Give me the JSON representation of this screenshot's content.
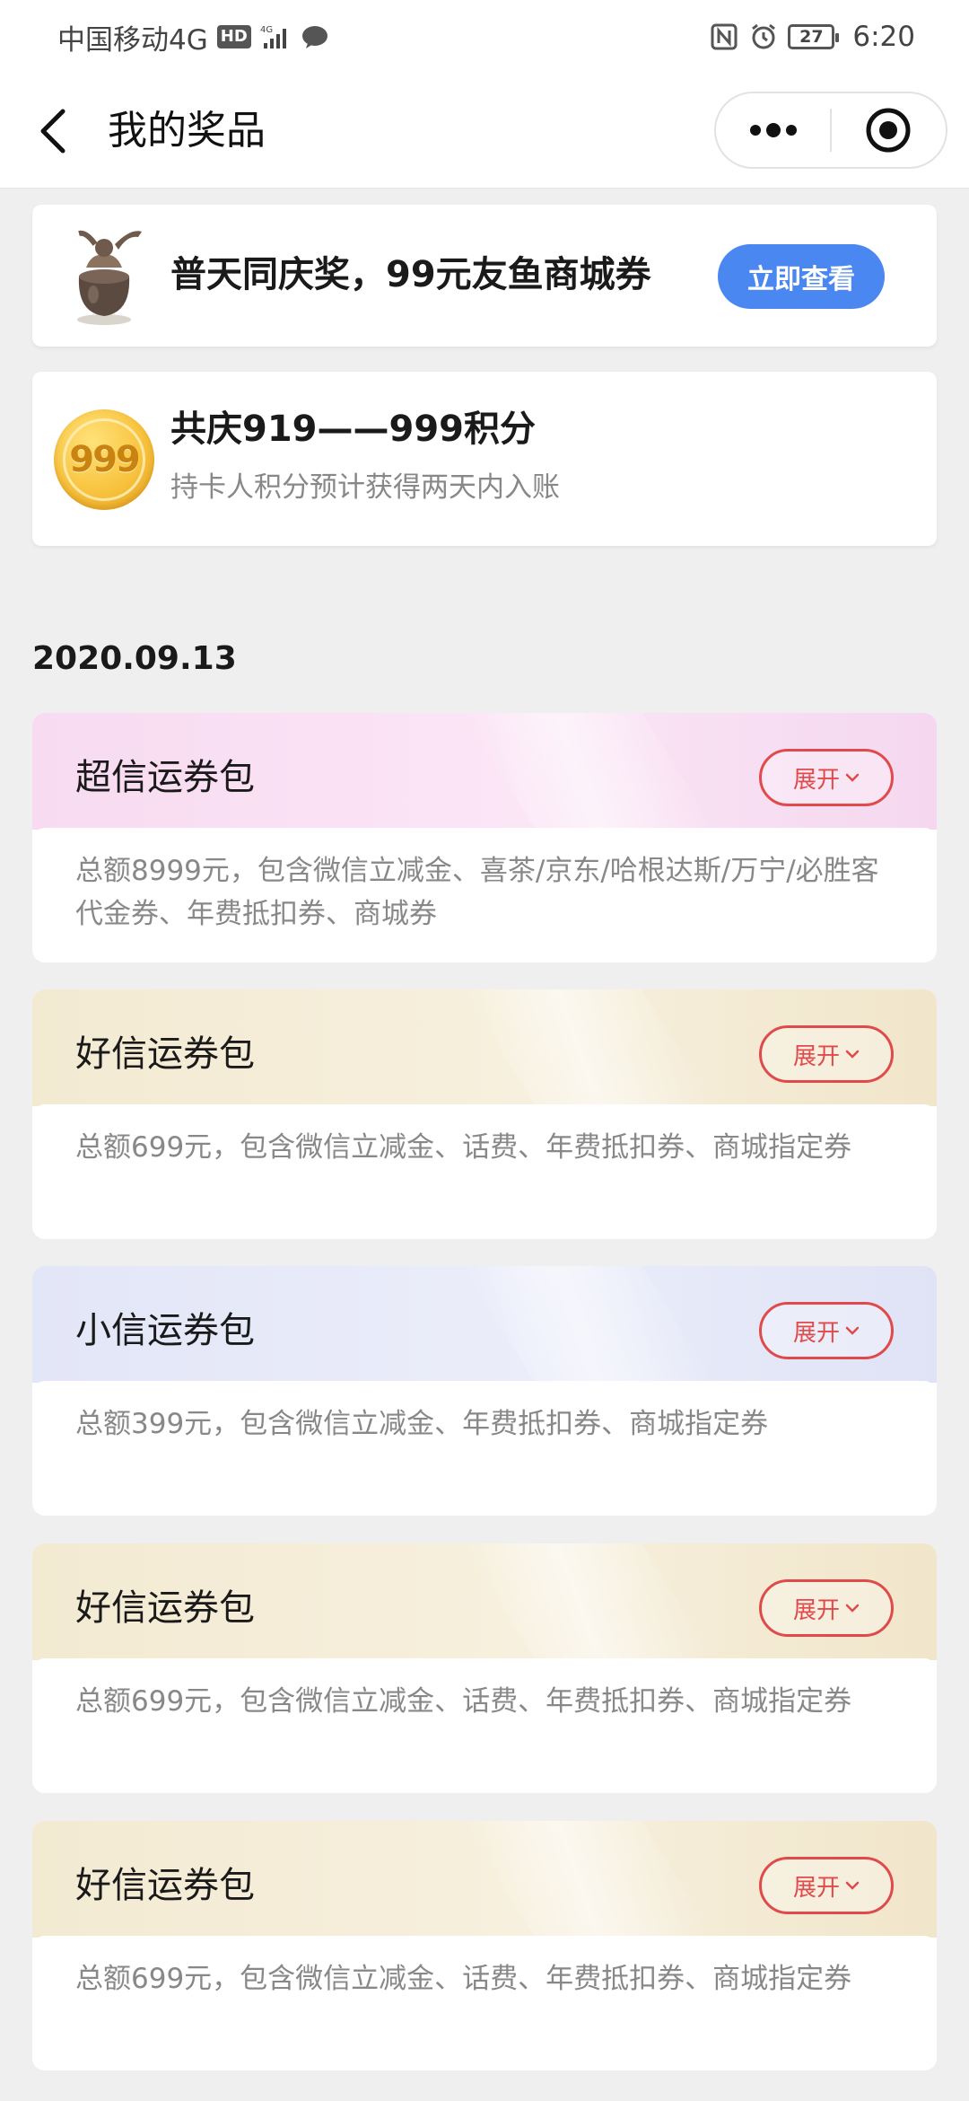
{
  "status_bar": {
    "carrier": "中国移动4G",
    "hd_badge": "HD",
    "network": "4G",
    "battery_level": "27",
    "time": "6:20"
  },
  "nav": {
    "title": "我的奖品"
  },
  "prizes": [
    {
      "title": "普天同庆奖，99元友鱼商城券",
      "button_label": "立即查看"
    },
    {
      "coin_label": "999",
      "title": "共庆919——999积分",
      "subtitle": "持卡人积分预计获得两天内入账"
    }
  ],
  "date": "2020.09.13",
  "packs": [
    {
      "name": "超信运券包",
      "expand_label": "展开",
      "description": "总额8999元，包含微信立减金、喜茶/京东/哈根达斯/万宁/必胜客代金券、年费抵扣券、商城券",
      "theme_color": "#f8dbf1"
    },
    {
      "name": "好信运券包",
      "expand_label": "展开",
      "description": "总额699元，包含微信立减金、话费、年费抵扣券、商城指定券",
      "theme_color": "#f3ead2"
    },
    {
      "name": "小信运券包",
      "expand_label": "展开",
      "description": "总额399元，包含微信立减金、年费抵扣券、商城指定券",
      "theme_color": "#e3e6f7"
    },
    {
      "name": "好信运券包",
      "expand_label": "展开",
      "description": "总额699元，包含微信立减金、话费、年费抵扣券、商城指定券",
      "theme_color": "#f3ead2"
    },
    {
      "name": "好信运券包",
      "expand_label": "展开",
      "description": "总额699元，包含微信立减金、话费、年费抵扣券、商城指定券",
      "theme_color": "#f3ead2"
    }
  ],
  "colors": {
    "primary_button": "#4a87f0",
    "expand_accent": "#e04a4a"
  }
}
